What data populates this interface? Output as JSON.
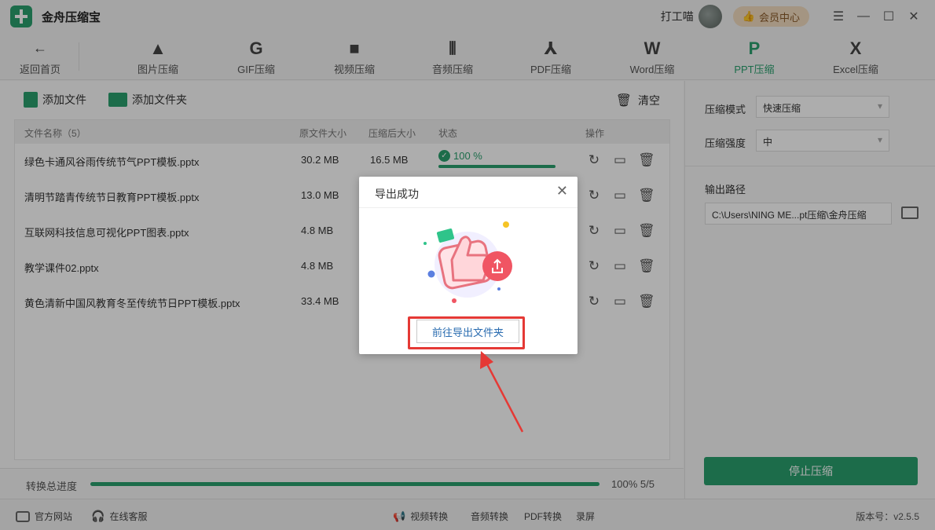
{
  "app": {
    "title": "金舟压缩宝",
    "username": "打工喵",
    "vip_label": "会员中心"
  },
  "toolbar": {
    "back_label": "返回首页",
    "tools": [
      {
        "label": "图片压缩",
        "icon": "image-compress-icon"
      },
      {
        "label": "GIF压缩",
        "icon": "gif-compress-icon"
      },
      {
        "label": "视频压缩",
        "icon": "video-compress-icon"
      },
      {
        "label": "音频压缩",
        "icon": "audio-compress-icon"
      },
      {
        "label": "PDF压缩",
        "icon": "pdf-compress-icon"
      },
      {
        "label": "Word压缩",
        "icon": "word-compress-icon"
      },
      {
        "label": "PPT压缩",
        "icon": "ppt-compress-icon",
        "active": true
      },
      {
        "label": "Excel压缩",
        "icon": "excel-compress-icon"
      }
    ]
  },
  "actions": {
    "add_file": "添加文件",
    "add_folder": "添加文件夹",
    "clear": "清空"
  },
  "table": {
    "headers": {
      "name": "文件名称（5）",
      "orig_size": "原文件大小",
      "comp_size": "压缩后大小",
      "status": "状态",
      "ops": "操作"
    },
    "rows": [
      {
        "name": "绿色卡通风谷雨传统节气PPT模板.pptx",
        "orig_size": "30.2 MB",
        "comp_size": "16.5 MB",
        "status": "100 %",
        "progress": 1.0
      },
      {
        "name": "清明节踏青传统节日教育PPT模板.pptx",
        "orig_size": "13.0 MB"
      },
      {
        "name": "互联网科技信息可视化PPT图表.pptx",
        "orig_size": "4.8 MB"
      },
      {
        "name": "教学课件02.pptx",
        "orig_size": "4.8 MB"
      },
      {
        "name": "黄色清新中国风教育冬至传统节日PPT模板.pptx",
        "orig_size": "33.4 MB"
      }
    ]
  },
  "progress": {
    "label": "转换总进度",
    "value_text": "100%  5/5",
    "fraction": 1.0
  },
  "side": {
    "mode_label": "压缩模式",
    "mode_value": "快速压缩",
    "strength_label": "压缩强度",
    "strength_value": "中",
    "output_label": "输出路径",
    "output_path": "C:\\Users\\NING ME...pt压缩\\金舟压缩",
    "stop_label": "停止压缩"
  },
  "footer": {
    "website": "官方网站",
    "service": "在线客服",
    "links": [
      "视频转换",
      "音频转换",
      "PDF转换",
      "录屏"
    ],
    "version": "版本号：v2.5.5"
  },
  "dialog": {
    "title": "导出成功",
    "button": "前往导出文件夹"
  },
  "colors": {
    "accent": "#2aa06e",
    "highlight": "#e53935",
    "link": "#2a6cb0"
  }
}
